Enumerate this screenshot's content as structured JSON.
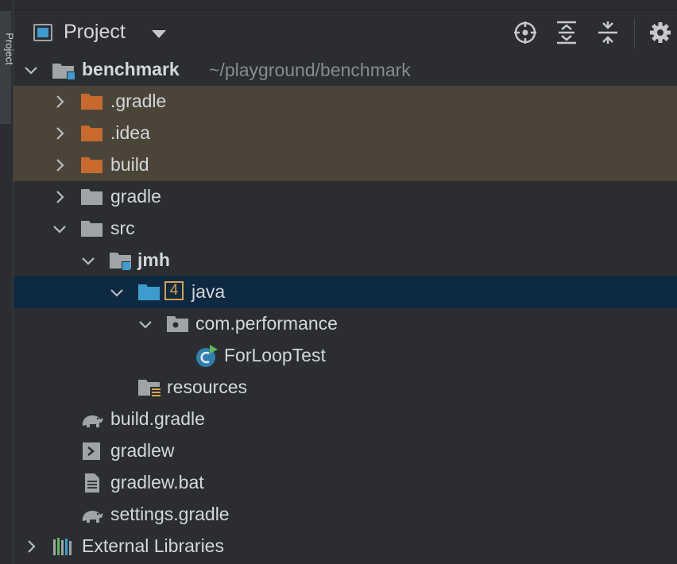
{
  "side_tab": {
    "label": "Project"
  },
  "header": {
    "title": "Project",
    "icons": [
      "locate-icon",
      "expand-all-icon",
      "collapse-all-icon",
      "gear-icon"
    ]
  },
  "tree": {
    "root": {
      "name": "benchmark",
      "path": "~/playground/benchmark"
    },
    "items": [
      {
        "label": ".gradle"
      },
      {
        "label": ".idea"
      },
      {
        "label": "build"
      },
      {
        "label": "gradle"
      },
      {
        "label": "src"
      },
      {
        "label": "jmh"
      },
      {
        "label": "java",
        "badge": "4"
      },
      {
        "label": "com.performance"
      },
      {
        "label": "ForLoopTest"
      },
      {
        "label": "resources"
      },
      {
        "label": "build.gradle"
      },
      {
        "label": "gradlew"
      },
      {
        "label": "gradlew.bat"
      },
      {
        "label": "settings.gradle"
      },
      {
        "label": "External Libraries"
      }
    ]
  },
  "colors": {
    "background": "#2b2d30",
    "excluded_row": "#4a4538",
    "selected_row": "#0e2942",
    "excluded_folder": "#c8692d",
    "source_folder": "#3d9ccf",
    "folder": "#a0a4a8"
  }
}
